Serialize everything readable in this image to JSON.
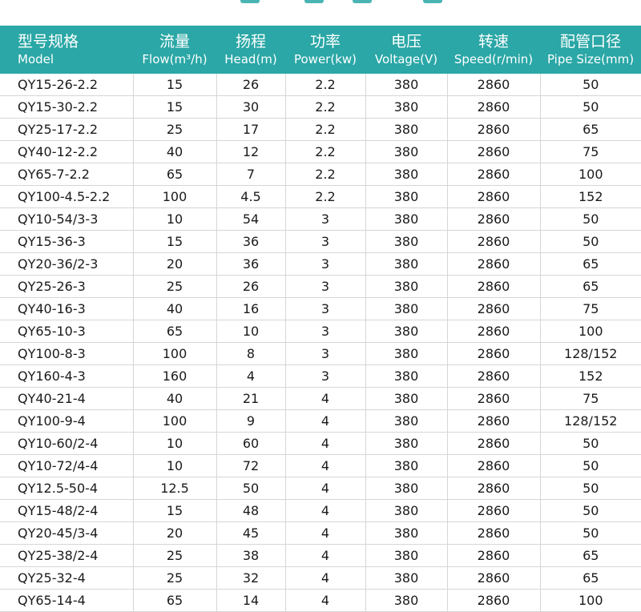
{
  "colors": {
    "header_bg": "#2aa7a6",
    "header_text": "#ffffff",
    "grid_line": "#d6d6d6"
  },
  "table": {
    "columns": [
      {
        "zh": "型号规格",
        "en": "Model"
      },
      {
        "zh": "流量",
        "en": "Flow(m³/h)"
      },
      {
        "zh": "扬程",
        "en": "Head(m)"
      },
      {
        "zh": "功率",
        "en": "Power(kw)"
      },
      {
        "zh": "电压",
        "en": "Voltage(V)"
      },
      {
        "zh": "转速",
        "en": "Speed(r/min)"
      },
      {
        "zh": "配管口径",
        "en": "Pipe Size(mm)"
      }
    ],
    "rows": [
      [
        "QY15-26-2.2",
        "15",
        "26",
        "2.2",
        "380",
        "2860",
        "50"
      ],
      [
        "QY15-30-2.2",
        "15",
        "30",
        "2.2",
        "380",
        "2860",
        "50"
      ],
      [
        "QY25-17-2.2",
        "25",
        "17",
        "2.2",
        "380",
        "2860",
        "65"
      ],
      [
        "QY40-12-2.2",
        "40",
        "12",
        "2.2",
        "380",
        "2860",
        "75"
      ],
      [
        "QY65-7-2.2",
        "65",
        "7",
        "2.2",
        "380",
        "2860",
        "100"
      ],
      [
        "QY100-4.5-2.2",
        "100",
        "4.5",
        "2.2",
        "380",
        "2860",
        "152"
      ],
      [
        "QY10-54/3-3",
        "10",
        "54",
        "3",
        "380",
        "2860",
        "50"
      ],
      [
        "QY15-36-3",
        "15",
        "36",
        "3",
        "380",
        "2860",
        "50"
      ],
      [
        "QY20-36/2-3",
        "20",
        "36",
        "3",
        "380",
        "2860",
        "65"
      ],
      [
        "QY25-26-3",
        "25",
        "26",
        "3",
        "380",
        "2860",
        "65"
      ],
      [
        "QY40-16-3",
        "40",
        "16",
        "3",
        "380",
        "2860",
        "75"
      ],
      [
        "QY65-10-3",
        "65",
        "10",
        "3",
        "380",
        "2860",
        "100"
      ],
      [
        "QY100-8-3",
        "100",
        "8",
        "3",
        "380",
        "2860",
        "128/152"
      ],
      [
        "QY160-4-3",
        "160",
        "4",
        "3",
        "380",
        "2860",
        "152"
      ],
      [
        "QY40-21-4",
        "40",
        "21",
        "4",
        "380",
        "2860",
        "75"
      ],
      [
        "QY100-9-4",
        "100",
        "9",
        "4",
        "380",
        "2860",
        "128/152"
      ],
      [
        "QY10-60/2-4",
        "10",
        "60",
        "4",
        "380",
        "2860",
        "50"
      ],
      [
        "QY10-72/4-4",
        "10",
        "72",
        "4",
        "380",
        "2860",
        "50"
      ],
      [
        "QY12.5-50-4",
        "12.5",
        "50",
        "4",
        "380",
        "2860",
        "50"
      ],
      [
        "QY15-48/2-4",
        "15",
        "48",
        "4",
        "380",
        "2860",
        "50"
      ],
      [
        "QY20-45/3-4",
        "20",
        "45",
        "4",
        "380",
        "2860",
        "50"
      ],
      [
        "QY25-38/2-4",
        "25",
        "38",
        "4",
        "380",
        "2860",
        "65"
      ],
      [
        "QY25-32-4",
        "25",
        "32",
        "4",
        "380",
        "2860",
        "65"
      ],
      [
        "QY65-14-4",
        "65",
        "14",
        "4",
        "380",
        "2860",
        "100"
      ]
    ]
  }
}
